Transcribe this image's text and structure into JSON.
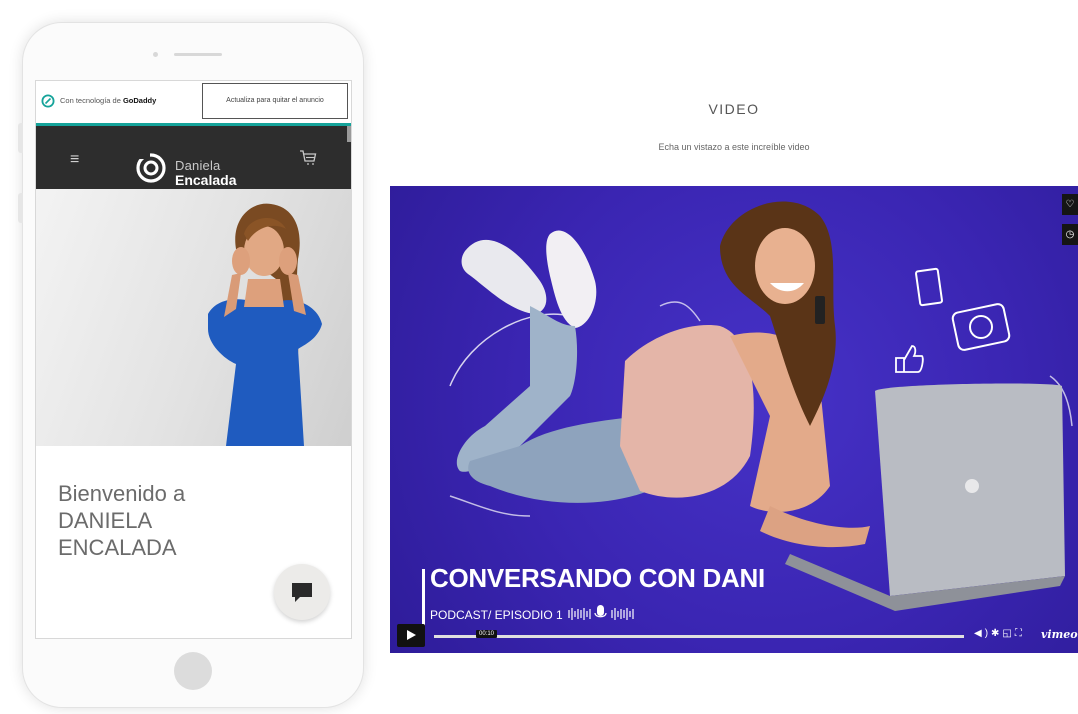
{
  "phone": {
    "godaddy_banner": {
      "text_prefix": "Con tecnología de ",
      "brand": "GoDaddy",
      "upgrade_button": "Actualiza para quitar el anuncio",
      "accent_color": "#15a39a"
    },
    "header": {
      "menu_icon": "hamburger-menu-icon",
      "logo_first": "Daniela",
      "logo_last": "Encalada",
      "cart_icon": "shopping-cart-icon",
      "background": "#2d2d2d"
    },
    "welcome_line1": "Bienvenido a",
    "welcome_line2": "DANIELA",
    "welcome_line3": "ENCALADA",
    "chat_icon": "chat-bubble-icon"
  },
  "video_section": {
    "title": "VIDEO",
    "subtitle": "Echa un vistazo a este increíble video",
    "video": {
      "title": "CONVERSANDO CON DANI",
      "subtitle": "PODCAST/ EPISODIO 1",
      "time": "00:10",
      "controls": [
        "volume-icon",
        "settings-icon",
        "pip-icon",
        "fullscreen-icon"
      ],
      "side_controls": [
        "heart-icon",
        "clock-icon"
      ],
      "provider": "vimeo",
      "background": "#3a25b2"
    }
  }
}
